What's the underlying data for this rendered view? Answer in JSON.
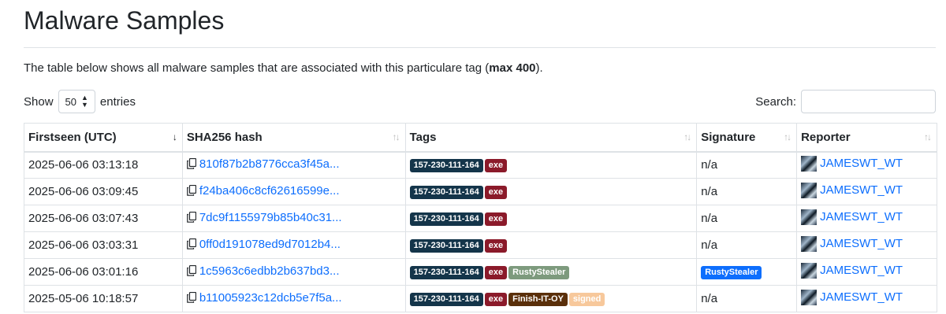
{
  "page": {
    "title": "Malware Samples",
    "intro_prefix": "The table below shows all malware samples that are associated with this particulare tag (",
    "intro_bold": "max 400",
    "intro_suffix": ")."
  },
  "controls": {
    "show_label": "Show",
    "entries_value": "50",
    "entries_label": "entries",
    "search_label": "Search:",
    "search_value": ""
  },
  "table": {
    "headers": [
      "Firstseen (UTC)",
      "SHA256 hash",
      "Tags",
      "Signature",
      "Reporter"
    ],
    "rows": [
      {
        "firstseen": "2025-06-06 03:13:18",
        "hash": "810f87b2b8776cca3f45a...",
        "tags": [
          {
            "text": "157-230-111-164",
            "color": "#14354a"
          },
          {
            "text": "exe",
            "color": "#8b1a2a"
          }
        ],
        "signature": "n/a",
        "reporter": "JAMESWT_WT"
      },
      {
        "firstseen": "2025-06-06 03:09:45",
        "hash": "f24ba406c8cf62616599e...",
        "tags": [
          {
            "text": "157-230-111-164",
            "color": "#14354a"
          },
          {
            "text": "exe",
            "color": "#8b1a2a"
          }
        ],
        "signature": "n/a",
        "reporter": "JAMESWT_WT"
      },
      {
        "firstseen": "2025-06-06 03:07:43",
        "hash": "7dc9f1155979b85b40c31...",
        "tags": [
          {
            "text": "157-230-111-164",
            "color": "#14354a"
          },
          {
            "text": "exe",
            "color": "#8b1a2a"
          }
        ],
        "signature": "n/a",
        "reporter": "JAMESWT_WT"
      },
      {
        "firstseen": "2025-06-06 03:03:31",
        "hash": "0ff0d191078ed9d7012b4...",
        "tags": [
          {
            "text": "157-230-111-164",
            "color": "#14354a"
          },
          {
            "text": "exe",
            "color": "#8b1a2a"
          }
        ],
        "signature": "n/a",
        "reporter": "JAMESWT_WT"
      },
      {
        "firstseen": "2025-06-06 03:01:16",
        "hash": "1c5963c6edbb2b637bd3...",
        "tags": [
          {
            "text": "157-230-111-164",
            "color": "#14354a"
          },
          {
            "text": "exe",
            "color": "#8b1a2a"
          },
          {
            "text": "RustyStealer",
            "color": "#7d9a7d"
          }
        ],
        "signature": "RustyStealer",
        "signature_badge": true,
        "reporter": "JAMESWT_WT"
      },
      {
        "firstseen": "2025-05-06 10:18:57",
        "hash": "b11005923c12dcb5e7f5a...",
        "tags": [
          {
            "text": "157-230-111-164",
            "color": "#14354a"
          },
          {
            "text": "exe",
            "color": "#8b1a2a"
          },
          {
            "text": "Finish-IT-OY",
            "color": "#5a2f0a"
          },
          {
            "text": "signed",
            "color": "#f7c89b"
          }
        ],
        "signature": "n/a",
        "reporter": "JAMESWT_WT"
      }
    ]
  },
  "colors": {
    "link": "#0d6efd",
    "signature_badge": "#0d6efd"
  }
}
